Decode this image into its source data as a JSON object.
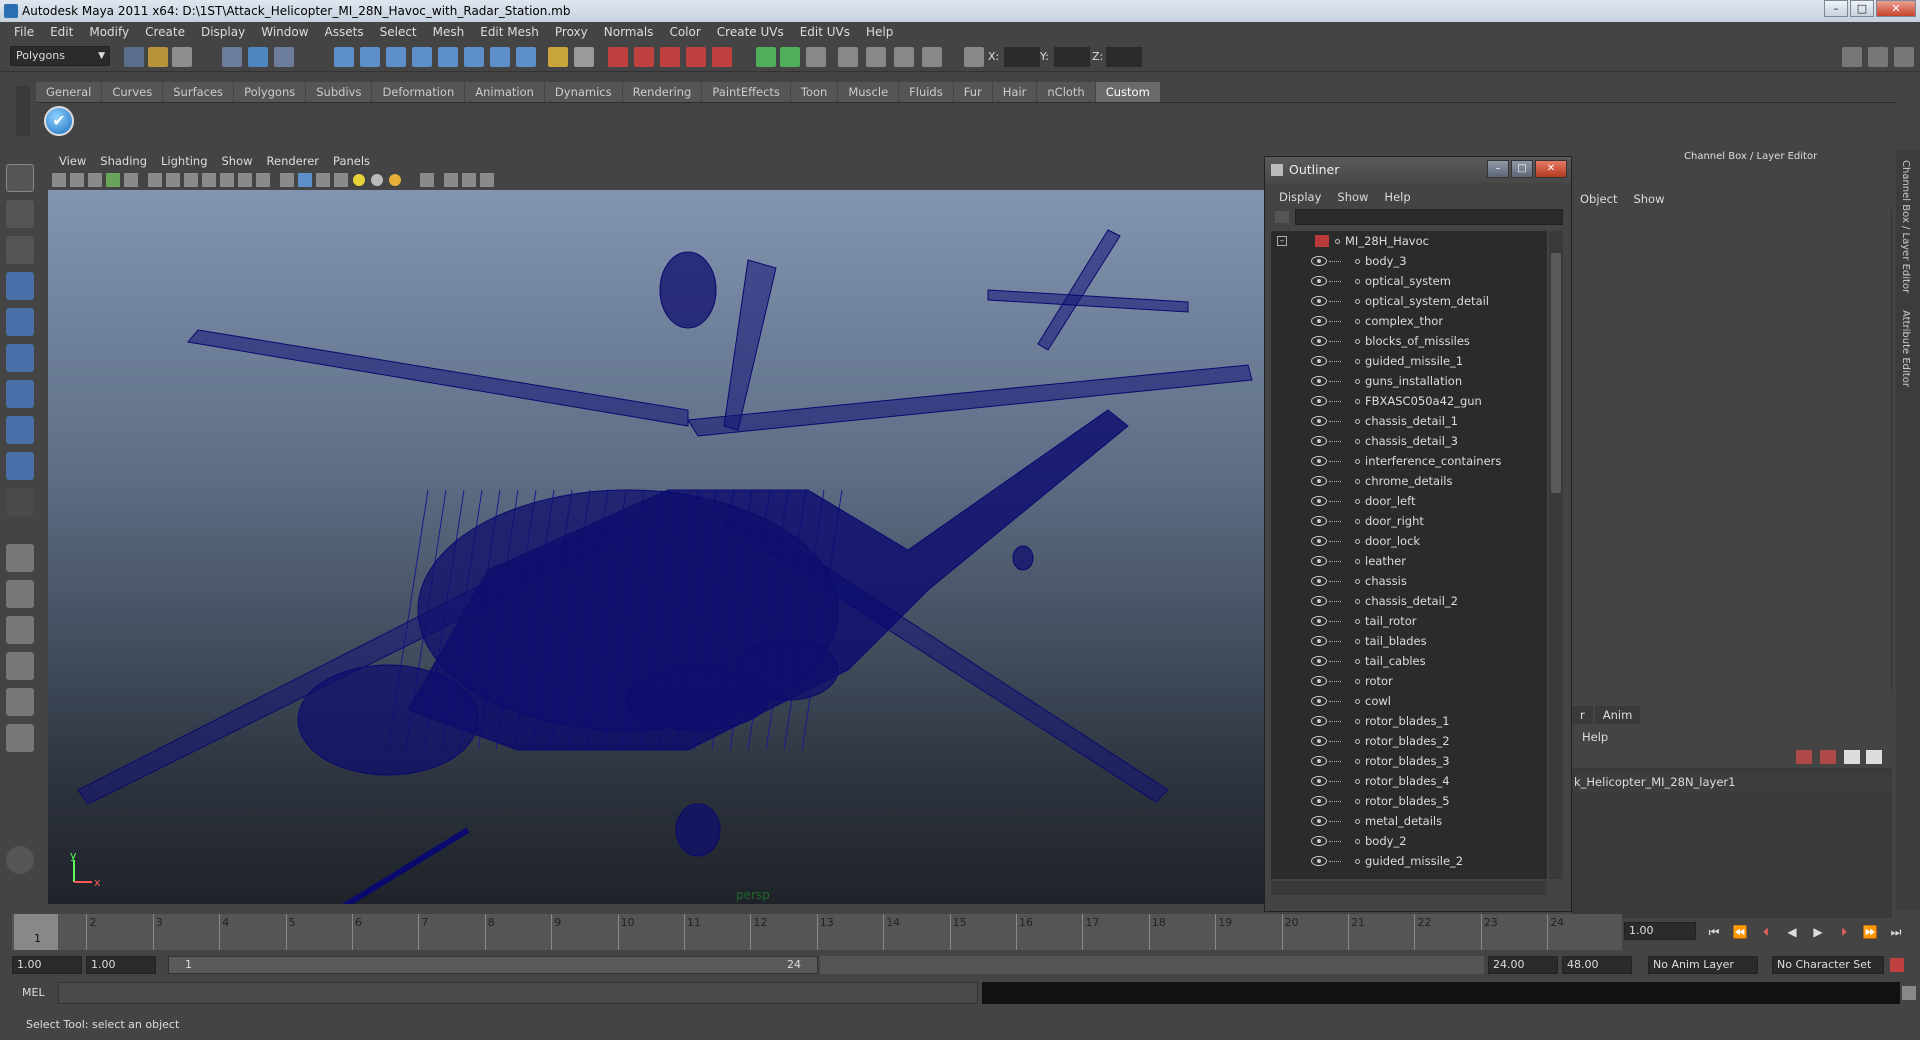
{
  "window": {
    "title": "Autodesk Maya 2011 x64: D:\\1ST\\Attack_Helicopter_MI_28N_Havoc_with_Radar_Station.mb",
    "min": "–",
    "max": "□",
    "close": "✕"
  },
  "menubar": [
    "File",
    "Edit",
    "Modify",
    "Create",
    "Display",
    "Window",
    "Assets",
    "Select",
    "Mesh",
    "Edit Mesh",
    "Proxy",
    "Normals",
    "Color",
    "Create UVs",
    "Edit UVs",
    "Help"
  ],
  "status": {
    "mode": "Polygons",
    "x_label": "X:",
    "y_label": "Y:",
    "z_label": "Z:"
  },
  "shelf_tabs": [
    "General",
    "Curves",
    "Surfaces",
    "Polygons",
    "Subdivs",
    "Deformation",
    "Animation",
    "Dynamics",
    "Rendering",
    "PaintEffects",
    "Toon",
    "Muscle",
    "Fluids",
    "Fur",
    "Hair",
    "nCloth",
    "Custom"
  ],
  "shelf_active": "Custom",
  "viewport": {
    "menu": [
      "View",
      "Shading",
      "Lighting",
      "Show",
      "Renderer",
      "Panels"
    ],
    "camera": "persp",
    "axis_y": "y",
    "axis_x": "x",
    "wire_color": "#0a0a6e"
  },
  "outliner": {
    "title": "Outliner",
    "menu": [
      "Display",
      "Show",
      "Help"
    ],
    "root": "MI_28H_Havoc",
    "items": [
      "body_3",
      "optical_system",
      "optical_system_detail",
      "complex_thor",
      "blocks_of_missiles",
      "guided_missile_1",
      "guns_installation",
      "FBXASC050a42_gun",
      "chassis_detail_1",
      "chassis_detail_3",
      "interference_containers",
      "chrome_details",
      "door_left",
      "door_right",
      "door_lock",
      "leather",
      "chassis",
      "chassis_detail_2",
      "tail_rotor",
      "tail_blades",
      "tail_cables",
      "rotor",
      "cowl",
      "rotor_blades_1",
      "rotor_blades_2",
      "rotor_blades_3",
      "rotor_blades_4",
      "rotor_blades_5",
      "metal_details",
      "body_2",
      "guided_missile_2"
    ]
  },
  "channel_box": {
    "title": "Channel Box / Layer Editor",
    "menu": [
      "Object",
      "Show"
    ],
    "layer_tabs": [
      "r",
      "Anim"
    ],
    "layer_help": "Help",
    "layer_name": "k_Helicopter_MI_28N_layer1"
  },
  "side_tabs": [
    "Channel Box / Layer Editor",
    "Attribute Editor"
  ],
  "timeline": {
    "ticks": [
      "1",
      "2",
      "3",
      "4",
      "5",
      "6",
      "7",
      "8",
      "9",
      "10",
      "11",
      "12",
      "13",
      "14",
      "15",
      "16",
      "17",
      "18",
      "19",
      "20",
      "21",
      "22",
      "23",
      "24"
    ],
    "current": "1",
    "current_time_field": "1.00"
  },
  "range": {
    "start_outer": "1.00",
    "start_inner": "1.00",
    "slider_start": "1",
    "slider_end": "24",
    "end_inner": "24.00",
    "end_outer": "48.00",
    "anim_layer": "No Anim Layer",
    "char_set": "No Character Set"
  },
  "command": {
    "label": "MEL"
  },
  "help_line": "Select Tool: select an object"
}
